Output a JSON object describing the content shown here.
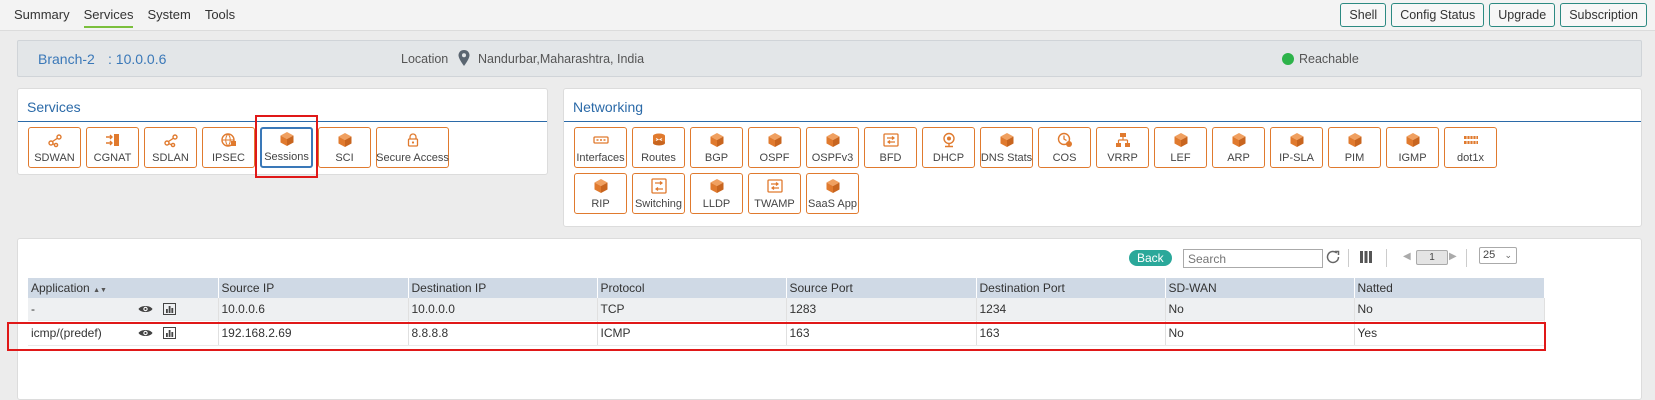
{
  "nav": {
    "tabs": [
      "Summary",
      "Services",
      "System",
      "Tools"
    ],
    "active_tab": "Services",
    "actions": [
      "Shell",
      "Config Status",
      "Upgrade",
      "Subscription"
    ]
  },
  "device": {
    "name": "Branch-2",
    "ip": ": 10.0.0.6",
    "location_label": "Location",
    "location": "Nandurbar,Maharashtra, India",
    "status": "Reachable",
    "status_color": "#2db34a"
  },
  "services": {
    "title": "Services",
    "items": [
      {
        "label": "SDWAN",
        "icon": "sdwan-icon"
      },
      {
        "label": "CGNAT",
        "icon": "cgnat-icon"
      },
      {
        "label": "SDLAN",
        "icon": "sdlan-icon"
      },
      {
        "label": "IPSEC",
        "icon": "ipsec-icon"
      },
      {
        "label": "Sessions",
        "icon": "cube-icon",
        "selected": true
      },
      {
        "label": "SCI",
        "icon": "cube-icon"
      },
      {
        "label": "Secure Access",
        "icon": "lock-icon"
      }
    ]
  },
  "networking": {
    "title": "Networking",
    "items": [
      {
        "label": "Interfaces",
        "icon": "interfaces-icon"
      },
      {
        "label": "Routes",
        "icon": "router-icon"
      },
      {
        "label": "BGP",
        "icon": "cube-icon"
      },
      {
        "label": "OSPF",
        "icon": "cube-icon"
      },
      {
        "label": "OSPFv3",
        "icon": "cube-icon"
      },
      {
        "label": "BFD",
        "icon": "bfd-icon"
      },
      {
        "label": "DHCP",
        "icon": "dhcp-icon"
      },
      {
        "label": "DNS Stats",
        "icon": "cube-icon"
      },
      {
        "label": "COS",
        "icon": "cos-icon"
      },
      {
        "label": "VRRP",
        "icon": "vrrp-icon"
      },
      {
        "label": "LEF",
        "icon": "cube-icon"
      },
      {
        "label": "ARP",
        "icon": "cube-icon"
      },
      {
        "label": "IP-SLA",
        "icon": "cube-icon"
      },
      {
        "label": "PIM",
        "icon": "cube-icon"
      },
      {
        "label": "IGMP",
        "icon": "cube-icon"
      },
      {
        "label": "dot1x",
        "icon": "dot1x-icon"
      },
      {
        "label": "RIP",
        "icon": "cube-icon"
      },
      {
        "label": "Switching",
        "icon": "switching-icon"
      },
      {
        "label": "LLDP",
        "icon": "cube-icon"
      },
      {
        "label": "TWAMP",
        "icon": "twamp-icon"
      },
      {
        "label": "SaaS App",
        "icon": "cube-icon"
      }
    ]
  },
  "toolbar": {
    "back_label": "Back",
    "search_placeholder": "Search",
    "page": "1",
    "page_size": "25"
  },
  "table": {
    "columns": [
      "Application",
      "Source IP",
      "Destination IP",
      "Protocol",
      "Source Port",
      "Destination Port",
      "SD-WAN",
      "Natted"
    ],
    "sort_indicator": "▲▼",
    "rows": [
      [
        "-",
        "10.0.0.6",
        "10.0.0.0",
        "TCP",
        "1283",
        "1234",
        "No",
        "No"
      ],
      [
        "icmp/(predef)",
        "192.168.2.69",
        "8.8.8.8",
        "ICMP",
        "163",
        "163",
        "No",
        "Yes"
      ]
    ]
  },
  "colors": {
    "accent_orange": "#e07a2e",
    "title_blue": "#2b6aa8",
    "highlight_red": "#e01818",
    "back_teal": "#2aa89a"
  }
}
